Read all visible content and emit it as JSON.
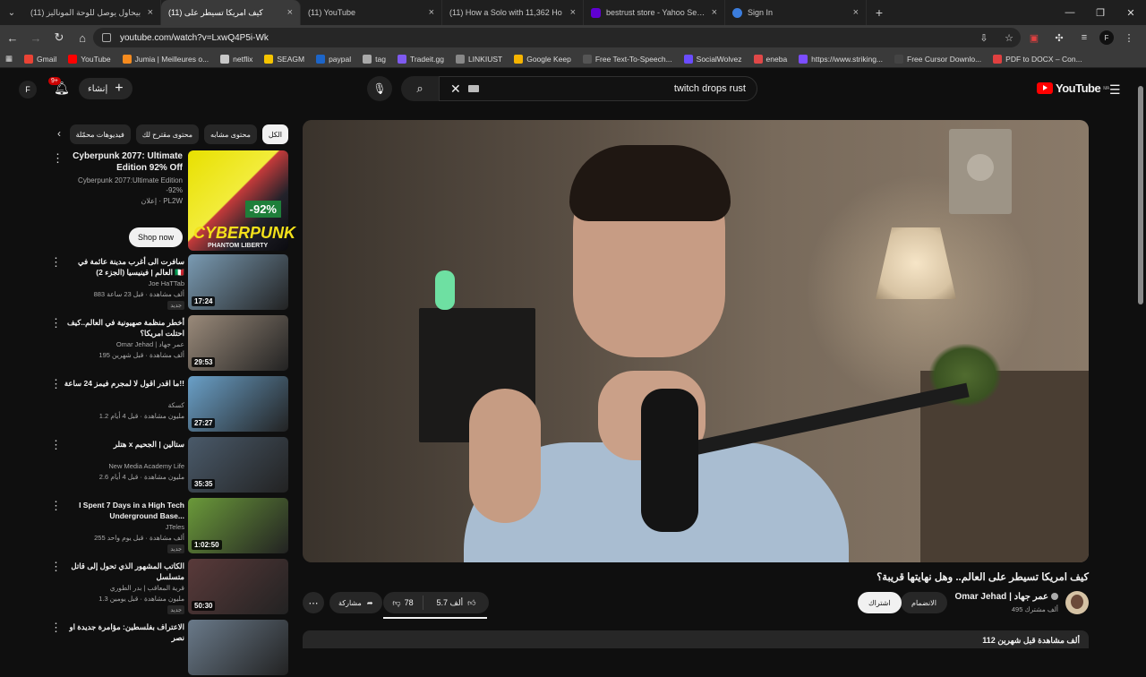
{
  "browser": {
    "tabs": [
      {
        "title": "(11) بيحاول يوصل للوحة الموناليز",
        "icon": "youtube-favicon",
        "active": false
      },
      {
        "title": "(11) كيف امريكا تسيطر على",
        "icon": "youtube-favicon",
        "active": true
      },
      {
        "title": "(11) YouTube",
        "icon": "youtube-favicon",
        "active": false
      },
      {
        "title": "(11) How a Solo with 11,362 Ho",
        "icon": "youtube-favicon",
        "active": false
      },
      {
        "title": "bestrust store - Yahoo Search R",
        "icon": "yahoo-favicon",
        "active": false
      },
      {
        "title": "Sign In",
        "icon": "steam-favicon",
        "active": false
      }
    ],
    "url": "youtube.com/watch?v=LxwQ4P5i-Wk",
    "bookmarks": [
      {
        "label": "Gmail",
        "color": "#ea4335"
      },
      {
        "label": "YouTube",
        "color": "#ff0000"
      },
      {
        "label": "Jumia | Meilleures o...",
        "color": "#f68b1e"
      },
      {
        "label": "netflix",
        "color": "#c8c8c8"
      },
      {
        "label": "SEAGM",
        "color": "#f5c400"
      },
      {
        "label": "paypal",
        "color": "#1c65c9"
      },
      {
        "label": "tag",
        "color": "#aaaaaa"
      },
      {
        "label": "Tradeit.gg",
        "color": "#7f5af0"
      },
      {
        "label": "LINKIUST",
        "color": "#888888"
      },
      {
        "label": "Google Keep",
        "color": "#f6b400"
      },
      {
        "label": "Free Text-To-Speech...",
        "color": "#555555"
      },
      {
        "label": "SocialWolvez",
        "color": "#6a4cff"
      },
      {
        "label": "eneba",
        "color": "#e04848"
      },
      {
        "label": "https://www.striking...",
        "color": "#7c4dff"
      },
      {
        "label": "Free Cursor Downlo...",
        "color": "#444444"
      },
      {
        "label": "PDF to DOCX – Con...",
        "color": "#e04040"
      }
    ]
  },
  "masthead": {
    "avatar_letter": "F",
    "notifications": "9+",
    "create_label": "إنشاء",
    "search_query": "twitch drops rust",
    "logo_text": "YouTube",
    "logo_region": "MA"
  },
  "chips": [
    "الكل",
    "محتوى مشابه",
    "محتوى مقترح لك",
    "فيديوهات محمّلة"
  ],
  "ad": {
    "title": "Cyberpunk 2077: Ultimate Edition 92% Off",
    "description": "Cyberpunk 2077:Ultimate Edition -92%",
    "sponsor": "إعلان · PL2W",
    "shop_label": "Shop now",
    "thumb_percent": "-92%",
    "thumb_word": "CYBERPUNK",
    "thumb_sub": "PHANTOM LIBERTY"
  },
  "videos": [
    {
      "title": "سافرت الى أغرب مدينة عائمة في العالم | فينيسيا (الجزء 2) 🇮🇹",
      "channel": "Joe HaTTab",
      "meta": "883 ألف مشاهدة · قبل 23 ساعة",
      "badge": "جديد",
      "duration": "17:24",
      "thumb_color": "#7a9bb3"
    },
    {
      "title": "أخطر منظمة صهيونية في العالم..كيف احتلت امريكا؟",
      "channel": "Omar Jehad | عمر جهاد",
      "meta": "195 ألف مشاهدة · قبل شهرين",
      "badge": "",
      "duration": "29:53",
      "thumb_color": "#9a8a7a"
    },
    {
      "title": "ما اقدر اقول لا لمجرم فيمز 24 ساعة!!",
      "channel": "كسكة",
      "meta": "1.2 مليون مشاهدة · قبل 4 أيام",
      "badge": "",
      "duration": "27:27",
      "thumb_color": "#6aa0c8"
    },
    {
      "title": "هتلر x ستالين | الجحيم",
      "channel": "New Media Academy Life",
      "meta": "2.6 مليون مشاهدة · قبل 4 أيام",
      "badge": "",
      "duration": "35:35",
      "thumb_color": "#4a5a6a"
    },
    {
      "title": "I Spent 7 Days in a High Tech Underground Base...",
      "channel": "JTeles",
      "meta": "255 ألف مشاهدة · قبل يوم واحد",
      "badge": "جديد",
      "duration": "1:02:50",
      "thumb_color": "#6b9a3a"
    },
    {
      "title": "الكاتب المشهور الذي تحول إلى قاتل متسلسل",
      "channel": "قرية المعاقب | بدر الطوري",
      "meta": "1.3 مليون مشاهدة · قبل يومين",
      "badge": "جديد",
      "duration": "50:30",
      "thumb_color": "#5a3a3a"
    },
    {
      "title": "الاعتراف بفلسطين: مؤامرة جديدة او نصر",
      "channel": "",
      "meta": "",
      "badge": "",
      "duration": "",
      "thumb_color": "#6a7a8a"
    }
  ],
  "watch": {
    "title": "كيف امريكا تسيطر على العالم.. وهل نهايتها قريبة؟",
    "channel_name": "Omar Jehad | عمر جهاد",
    "subscribers": "495 ألف مشترك",
    "join_label": "الانضمام",
    "subscribe_label": "اشتراك",
    "likes": "5.7 ألف",
    "dislikes": "78",
    "share_label": "مشاركة",
    "description_preview": "112 ألف مشاهدة قبل شهرين"
  }
}
